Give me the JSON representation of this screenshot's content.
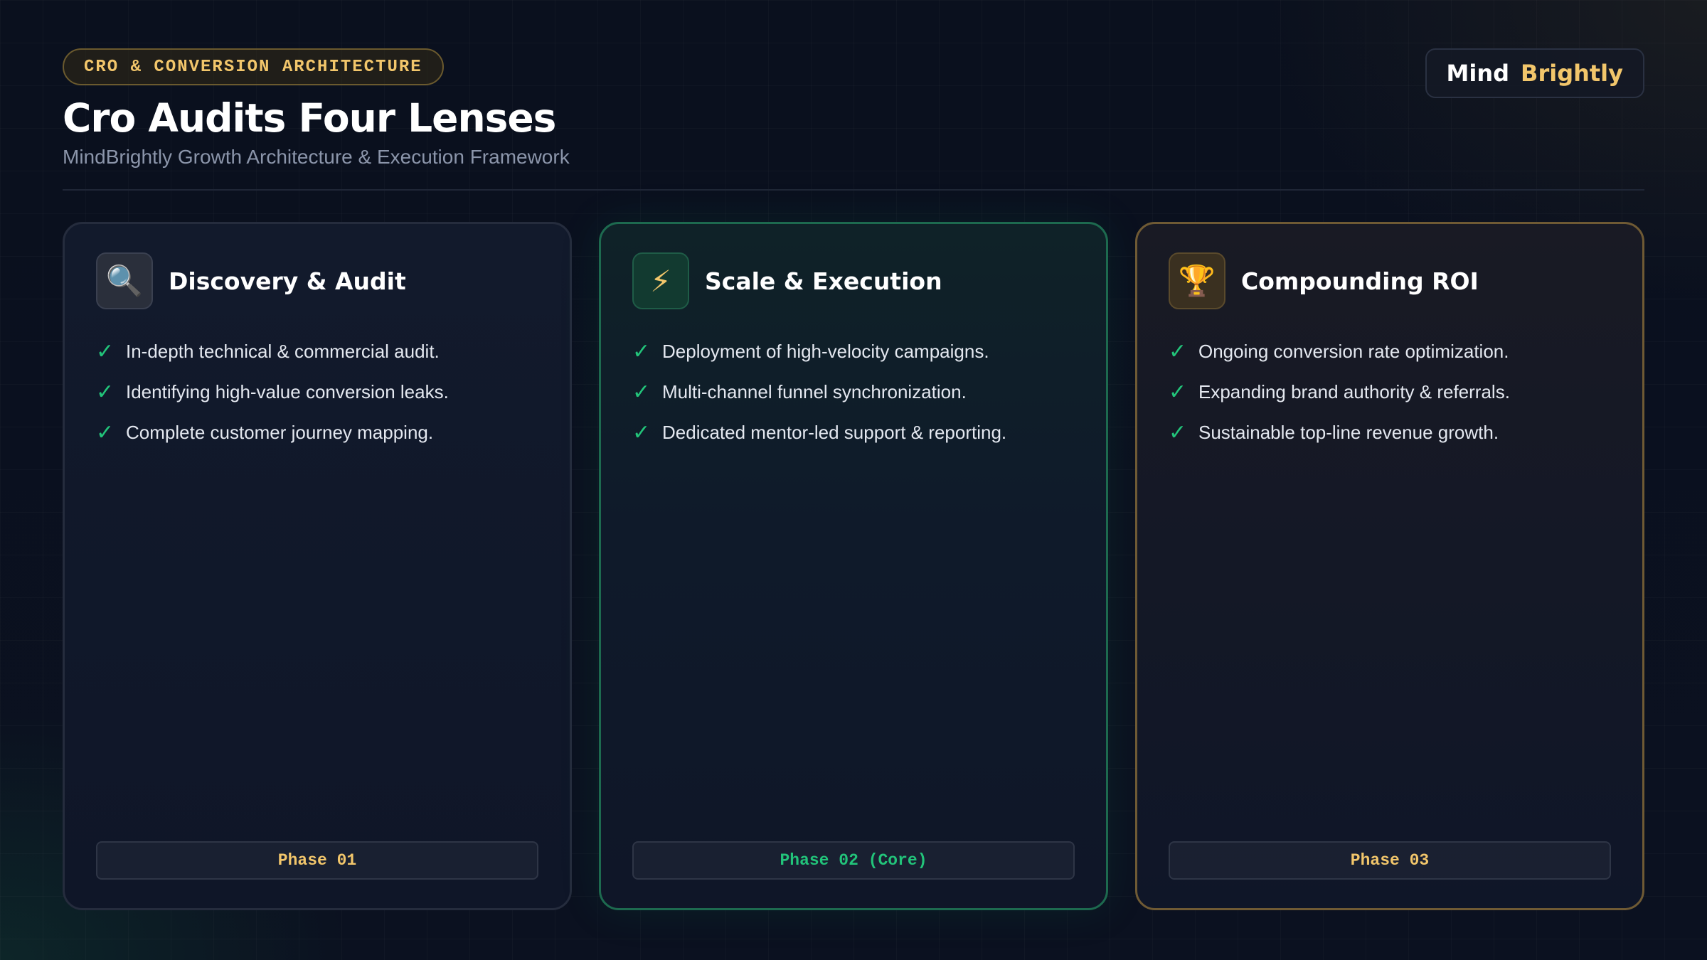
{
  "header": {
    "eyebrow": "CRO & CONVERSION ARCHITECTURE",
    "title": "Cro Audits Four Lenses",
    "subtitle": "MindBrightly Growth Architecture & Execution Framework"
  },
  "brand": {
    "part1": "Mind",
    "part2": "Brightly"
  },
  "colors": {
    "accent_gold": "#f2c66b",
    "accent_green": "#22c47a",
    "background": "#0a0f1d"
  },
  "cards": [
    {
      "icon": "magnifying-glass-icon",
      "icon_glyph": "🔍",
      "title": "Discovery & Audit",
      "bullets": [
        "In-depth technical & commercial audit.",
        "Identifying high-value conversion leaks.",
        "Complete customer journey mapping."
      ],
      "phase": "Phase 01"
    },
    {
      "icon": "lightning-bolt-icon",
      "icon_glyph": "⚡",
      "title": "Scale & Execution",
      "bullets": [
        "Deployment of high-velocity campaigns.",
        "Multi-channel funnel synchronization.",
        "Dedicated mentor-led support & reporting."
      ],
      "phase": "Phase 02 (Core)"
    },
    {
      "icon": "trophy-icon",
      "icon_glyph": "🏆",
      "title": "Compounding ROI",
      "bullets": [
        "Ongoing conversion rate optimization.",
        "Expanding brand authority & referrals.",
        "Sustainable top-line revenue growth."
      ],
      "phase": "Phase 03"
    }
  ],
  "check_glyph": "✓"
}
